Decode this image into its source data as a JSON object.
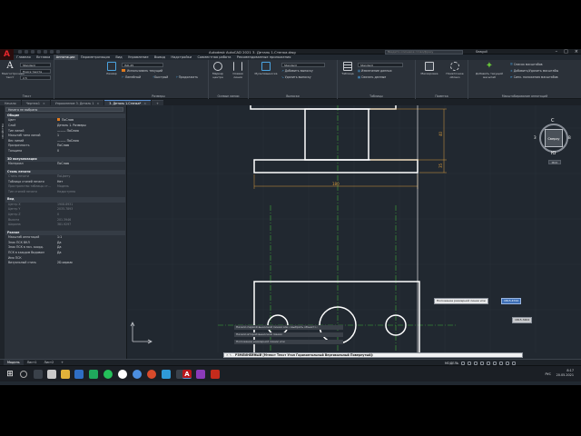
{
  "app": {
    "title": "Autodesk AutoCAD 2021   3. Деталь 1.Стенка.dwg",
    "search_placeholder": "Введите ключевое слово/фразу",
    "user": "Seagull",
    "logo_letter": "A"
  },
  "menu": [
    "Главная",
    "Вставка",
    "Аннотации",
    "Параметризация",
    "Вид",
    "Управление",
    "Вывод",
    "Надстройки",
    "Совместная работа",
    "Рекомендованные приложения"
  ],
  "menu_active_index": 2,
  "ribbon": {
    "text": {
      "big_label": "Многострочный текст",
      "style": "Standard",
      "find": "Поиск текста",
      "height": "2.5",
      "group": "Текст"
    },
    "dims": {
      "big_label": "Размер",
      "style": "ISO-25",
      "use_current": "Использовать текущий",
      "linear": "Линейный",
      "quick": "Быстрый",
      "continue": "Продолжить",
      "group": "Размеры"
    },
    "centerlines": {
      "center_mark": "Маркер центра",
      "center_line": "Осевая линия",
      "group": "Осевые линии"
    },
    "leaders": {
      "multileader": "Мультивыноска",
      "style": "Standard",
      "add": "Добавить выноску",
      "remove": "Удалить выноску",
      "group": "Выноски"
    },
    "tables": {
      "big_label": "Таблица",
      "style": "Standard",
      "extract": "Извлечение данных",
      "link": "Связать данные",
      "group": "Таблицы"
    },
    "markup": {
      "mask": "Маскировка",
      "cloud": "Пометочное облако",
      "group": "Пометка"
    },
    "scale": {
      "add_current": "Добавить текущий масштаб",
      "list": "Список масштабов",
      "add_delete": "Добавить/Удалить масштабы",
      "sync": "Синх. положения масштабов",
      "group": "Масштабирование аннотаций"
    }
  },
  "tabs": [
    {
      "label": "Начало",
      "active": false
    },
    {
      "label": "Чертеж1",
      "active": false
    },
    {
      "label": "Упражнение 3. Деталь 1",
      "active": false
    },
    {
      "label": "3. Деталь 1.Стенка*",
      "active": true
    }
  ],
  "properties": {
    "strip_label": "СВОЙСТВА",
    "selection": "Ничего не выбрано",
    "sections": [
      {
        "title": "Общие",
        "rows": [
          {
            "k": "Цвет",
            "v": "ПоСлою",
            "swatch": "#e07a1e"
          },
          {
            "k": "Слой",
            "v": "Деталь 1. Размеры"
          },
          {
            "k": "Тип линий",
            "v": "——— ПоСлою"
          },
          {
            "k": "Масштаб типа линий",
            "v": "1"
          },
          {
            "k": "Вес линий",
            "v": "——— ПоСлою"
          },
          {
            "k": "Прозрачность",
            "v": "ПоСлою"
          },
          {
            "k": "Толщина",
            "v": "0"
          }
        ]
      },
      {
        "title": "3D визуализация",
        "rows": [
          {
            "k": "Материал",
            "v": "ПоСлою"
          }
        ]
      },
      {
        "title": "Стиль печати",
        "rows": [
          {
            "k": "Стиль печати",
            "v": "ПоЦвету",
            "dim": true
          },
          {
            "k": "Таблица стилей печати",
            "v": "Нет"
          },
          {
            "k": "Пространство таблицы ст...",
            "v": "Модель",
            "dim": true
          },
          {
            "k": "Тип стилей печати",
            "v": "Недоступно",
            "dim": true
          }
        ]
      },
      {
        "title": "Вид",
        "rows": [
          {
            "k": "Центр X",
            "v": "1908.8931",
            "dim": true
          },
          {
            "k": "Центр Y",
            "v": "2035.7893",
            "dim": true
          },
          {
            "k": "Центр Z",
            "v": "0",
            "dim": true
          },
          {
            "k": "Высота",
            "v": "201.3946",
            "dim": true
          },
          {
            "k": "Ширина",
            "v": "381.9297",
            "dim": true
          }
        ]
      },
      {
        "title": "Разное",
        "rows": [
          {
            "k": "Масштаб аннотаций",
            "v": "1:1"
          },
          {
            "k": "Знак ПСК ВКЛ",
            "v": "Да"
          },
          {
            "k": "Знак ПСК в нач. коорд.",
            "v": "Да"
          },
          {
            "k": "ПСК в каждом Видовом",
            "v": "Да"
          },
          {
            "k": "Имя ПСК",
            "v": ""
          },
          {
            "k": "Визуальный стиль",
            "v": "2D-каркас"
          }
        ]
      }
    ]
  },
  "drawing": {
    "dim_width": "180",
    "dim_height_top": "40",
    "dim_height_bottom": "35",
    "prompt_tip": "Положение размерной линии или",
    "prompt_input": "1815.4742",
    "coord_tip": "1815.3464"
  },
  "viewcube": {
    "top": "Сверху",
    "north": "С",
    "south": "Ю",
    "east": "В",
    "west": "З",
    "wcs": "МСК"
  },
  "command": {
    "history": [
      "Начало первой выносной линии или <выбрать объект>:",
      "Начало второй выносной линии:",
      "Положение размерной линии или"
    ],
    "prefix": "✕ ✎ -",
    "current": "РЗМЛИНЕЙНЫЙ [Мтекст Текст Угол Горизонтальный Вертикальный Повернутый]:"
  },
  "status": {
    "tabs": [
      "Модель",
      "Лист1",
      "Лист2"
    ],
    "add": "+",
    "model": "МОДЕЛЬ"
  },
  "tray": {
    "lang": "РУС",
    "time": "8:17",
    "date": "20.05.2021"
  }
}
